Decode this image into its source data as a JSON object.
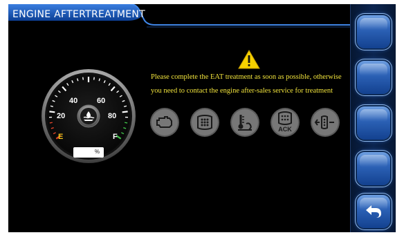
{
  "header": {
    "title": "ENGINE AFTERTREATMENT"
  },
  "warning": {
    "icon": "warning-triangle-icon",
    "line1": "Please complete the EAT treatment as soon as possible, otherwise",
    "line2": "you need to contact the engine after-sales service for treatment"
  },
  "gauge": {
    "ticks": [
      "20",
      "40",
      "60",
      "80"
    ],
    "empty_label": "E",
    "full_label": "F",
    "unit": "%",
    "icon": "def-fluid-icon"
  },
  "indicators": [
    {
      "name": "check-engine-icon"
    },
    {
      "name": "dpf-filter-icon"
    },
    {
      "name": "exhaust-temp-icon"
    },
    {
      "name": "dpf-ack-icon",
      "label": "ACK"
    },
    {
      "name": "regen-inhibit-icon"
    }
  ],
  "side_buttons": [
    {
      "name": "side-button-1"
    },
    {
      "name": "side-button-2"
    },
    {
      "name": "side-button-3"
    },
    {
      "name": "side-button-4"
    },
    {
      "name": "back-button",
      "icon": "back-arrow-icon"
    }
  ],
  "colors": {
    "accent": "#2e6fd8",
    "warning_text": "#f3e53c",
    "panel": "#0c2550"
  }
}
